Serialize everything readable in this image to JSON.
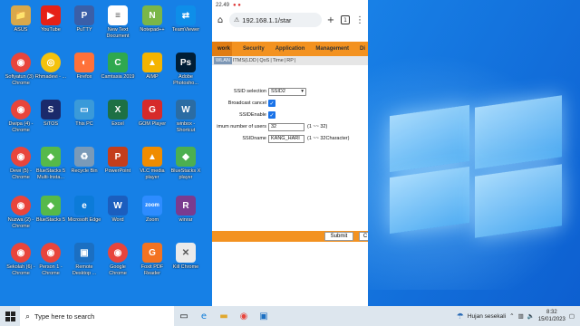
{
  "desktop": {
    "icons": [
      {
        "label": "ASUS",
        "color": "#d9a84b",
        "char": "📁"
      },
      {
        "label": "YouTube",
        "color": "#e62117",
        "char": "▶"
      },
      {
        "label": "PuTTY",
        "color": "#3a5fa8",
        "char": "P"
      },
      {
        "label": "New Text Document",
        "color": "#ffffff",
        "char": "≡"
      },
      {
        "label": "Notepad++",
        "color": "#7ab648",
        "char": "N"
      },
      {
        "label": "TeamViewer",
        "color": "#0e8ee9",
        "char": "⇄"
      },
      {
        "label": "Sofiyatun (3) - Chrome",
        "color": "#e8453c",
        "char": "◉"
      },
      {
        "label": "Rhmadevi - ...",
        "color": "#f4c20d",
        "char": "◎"
      },
      {
        "label": "Firefox",
        "color": "#ff7139",
        "char": "◐"
      },
      {
        "label": "Camtasia 2019",
        "color": "#2fa84f",
        "char": "C"
      },
      {
        "label": "AIMP",
        "color": "#f4b400",
        "char": "▲"
      },
      {
        "label": "Adobe Photosho...",
        "color": "#001e36",
        "char": "Ps"
      },
      {
        "label": "Dwipa (4) - Chrome",
        "color": "#e8453c",
        "char": "◉"
      },
      {
        "label": "SiTOS",
        "color": "#1b2a6b",
        "char": "S"
      },
      {
        "label": "This PC",
        "color": "#3a9ad9",
        "char": "▭"
      },
      {
        "label": "Excel",
        "color": "#1d7044",
        "char": "X"
      },
      {
        "label": "GOM Player",
        "color": "#d62a2a",
        "char": "G"
      },
      {
        "label": "winbox - Shortcut",
        "color": "#2b6ca3",
        "char": "W"
      },
      {
        "label": "Dewi (5) - Chrome",
        "color": "#e8453c",
        "char": "◉"
      },
      {
        "label": "BlueStacks 5 Multi-Insta...",
        "color": "#56b94a",
        "char": "◆"
      },
      {
        "label": "Recycle Bin",
        "color": "#7a9ab8",
        "char": "♻"
      },
      {
        "label": "PowerPoint",
        "color": "#c43e1c",
        "char": "P"
      },
      {
        "label": "VLC media player",
        "color": "#f08c00",
        "char": "▲"
      },
      {
        "label": "BlueStacks X player",
        "color": "#4caf50",
        "char": "◆"
      },
      {
        "label": "Nuzwa (2) - Chrome",
        "color": "#e8453c",
        "char": "◉"
      },
      {
        "label": "BlueStacks 5",
        "color": "#56b94a",
        "char": "◆"
      },
      {
        "label": "Microsoft Edge",
        "color": "#0c7bd8",
        "char": "e"
      },
      {
        "label": "Word",
        "color": "#1b5ebe",
        "char": "W"
      },
      {
        "label": "Zoom",
        "color": "#2d8cff",
        "char": "zoom"
      },
      {
        "label": "winrar",
        "color": "#7a3b8f",
        "char": "R"
      },
      {
        "label": "Sekolah (6) - Chrome",
        "color": "#e8453c",
        "char": "◉"
      },
      {
        "label": "Person 1 - Chrome",
        "color": "#e8453c",
        "char": "◉"
      },
      {
        "label": "Remote Desktop ...",
        "color": "#1b6fc2",
        "char": "▣"
      },
      {
        "label": "Google Chrome",
        "color": "#e8453c",
        "char": "◉"
      },
      {
        "label": "Foxit PDF Reader",
        "color": "#f37321",
        "char": "G"
      },
      {
        "label": "Kill Chrome",
        "color": "#eaeaea",
        "char": "✕"
      }
    ]
  },
  "browser": {
    "status_time": "22.49",
    "url": "192.168.1.1/star",
    "tab_count": "1",
    "nav_tabs": [
      "work",
      "Security",
      "Application",
      "Management",
      "Di"
    ],
    "sub_tabs": [
      "WLAN",
      "ITMS(LDD",
      "QoS",
      "Time",
      "RP"
    ],
    "form": {
      "ssid_selection_label": "SSID selection",
      "ssid_selection_value": "SSID2",
      "broadcast_label": "Broadcast cancel",
      "ssidenable_label": "SSIDEnable",
      "max_users_label": "imum number of users",
      "max_users_value": "32",
      "max_users_hint": "(1 ~~ 32)",
      "ssidname_label": "SSIDname",
      "ssidname_value": "KANG_HARI",
      "ssidname_hint": "(1 ~~ 32Character)"
    },
    "submit_label": "Submit",
    "cancel_label": "C"
  },
  "taskbar": {
    "search_placeholder": "Type here to search",
    "weather": "Hujan sesekali",
    "time": "8:32",
    "date": "15/01/2023"
  }
}
